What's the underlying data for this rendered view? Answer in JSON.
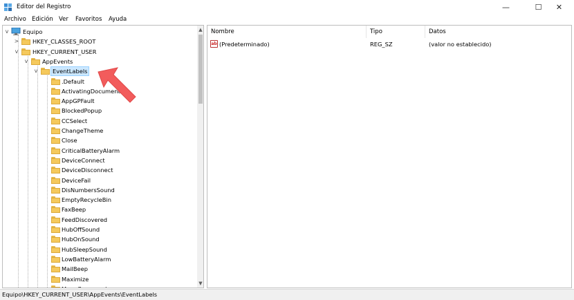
{
  "window": {
    "title": "Editor del Registro",
    "minimize": "—",
    "maximize": "☐",
    "close": "✕"
  },
  "menu": [
    "Archivo",
    "Edición",
    "Ver",
    "Favoritos",
    "Ayuda"
  ],
  "tree": {
    "root": "Equipo",
    "hkcr": "HKEY_CLASSES_ROOT",
    "hkcu": "HKEY_CURRENT_USER",
    "appevents": "AppEvents",
    "selected": "EventLabels",
    "children": [
      ".Default",
      "ActivatingDocument",
      "AppGPFault",
      "BlockedPopup",
      "CCSelect",
      "ChangeTheme",
      "Close",
      "CriticalBatteryAlarm",
      "DeviceConnect",
      "DeviceDisconnect",
      "DeviceFail",
      "DisNumbersSound",
      "EmptyRecycleBin",
      "FaxBeep",
      "FeedDiscovered",
      "HubOffSound",
      "HubOnSound",
      "HubSleepSound",
      "LowBatteryAlarm",
      "MailBeep",
      "Maximize",
      "MenuCommand"
    ]
  },
  "list": {
    "columns": [
      "Nombre",
      "Tipo",
      "Datos"
    ],
    "rows": [
      {
        "name": "(Predeterminado)",
        "type": "REG_SZ",
        "data": "(valor no establecido)"
      }
    ]
  },
  "status": {
    "path": "Equipo\\HKEY_CURRENT_USER\\AppEvents\\EventLabels"
  },
  "colors": {
    "selection": "#cce8ff",
    "folder": "#f5c95c",
    "arrow": "#f25c5c"
  },
  "icons": {
    "computer": "computer-icon",
    "folder": "folder-icon",
    "string_value": "string-value-icon",
    "arrow": "pointer-arrow"
  }
}
